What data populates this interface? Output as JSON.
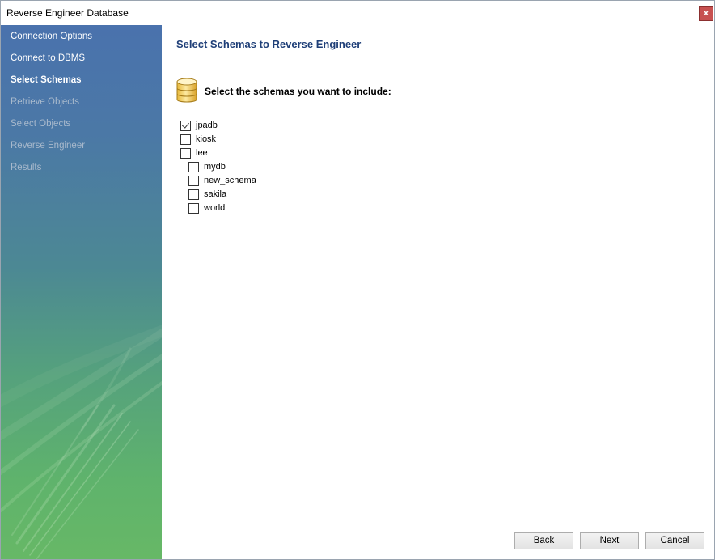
{
  "window": {
    "title": "Reverse Engineer Database",
    "close_label": "x"
  },
  "sidebar": {
    "steps": [
      {
        "label": "Connection Options",
        "state": "done"
      },
      {
        "label": "Connect to DBMS",
        "state": "done"
      },
      {
        "label": "Select Schemas",
        "state": "current"
      },
      {
        "label": "Retrieve Objects",
        "state": "pending"
      },
      {
        "label": "Select Objects",
        "state": "pending"
      },
      {
        "label": "Reverse Engineer",
        "state": "pending"
      },
      {
        "label": "Results",
        "state": "pending"
      }
    ]
  },
  "main": {
    "title": "Select Schemas to Reverse Engineer",
    "prompt": "Select the schemas you want to include:",
    "icon": "database-icon",
    "schemas": [
      {
        "name": "jpadb",
        "checked": true
      },
      {
        "name": "kiosk",
        "checked": false
      },
      {
        "name": "lee",
        "checked": false
      },
      {
        "name": "mydb",
        "checked": false
      },
      {
        "name": "new_schema",
        "checked": false
      },
      {
        "name": "sakila",
        "checked": false
      },
      {
        "name": "world",
        "checked": false
      }
    ]
  },
  "buttons": {
    "back": "Back",
    "next": "Next",
    "cancel": "Cancel"
  },
  "colors": {
    "title_blue": "#1f3f78",
    "close_red": "#c75050",
    "sidebar_top": "#4a72ad",
    "sidebar_bottom": "#67b866"
  }
}
